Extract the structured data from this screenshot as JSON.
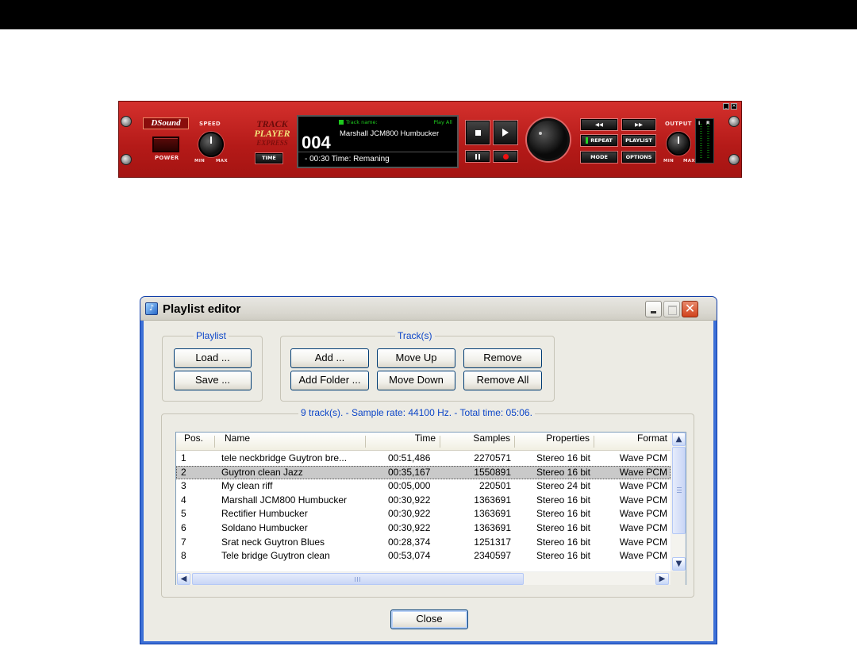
{
  "player": {
    "brand": "DSound",
    "speed_label": "SPEED",
    "power_label": "POWER",
    "min_label": "MIN",
    "max_label": "MAX",
    "logo_line1": "TRACK",
    "logo_line2": "PLAYER",
    "logo_line3": "EXPRESS",
    "time_button": "TIME",
    "display": {
      "track_name_label": "Track name:",
      "mode_label": "Play All",
      "track_number": "004",
      "track_title": "Marshall JCM800 Humbucker",
      "time_text": "- 00:30  Time: Remaning"
    },
    "buttons": {
      "rewind": "◀◀",
      "forward": "▶▶",
      "repeat": "REPEAT",
      "playlist": "PLAYLIST",
      "mode": "MODE",
      "options": "OPTIONS"
    },
    "output_label": "OUTPUT",
    "meter_left": "L",
    "meter_right": "R",
    "accent_color": "#c0201e"
  },
  "dialog": {
    "title": "Playlist editor",
    "playlist_group": "Playlist",
    "load": "Load ...",
    "save": "Save ...",
    "tracks_group": "Track(s)",
    "add": "Add ...",
    "add_folder": "Add Folder ...",
    "move_up": "Move Up",
    "move_down": "Move Down",
    "remove": "Remove",
    "remove_all": "Remove All",
    "summary": "9 track(s). - Sample rate: 44100 Hz. - Total time:   05:06.",
    "close": "Close",
    "columns": {
      "pos": "Pos.",
      "name": "Name",
      "time": "Time",
      "samples": "Samples",
      "properties": "Properties",
      "format": "Format"
    },
    "rows": [
      {
        "pos": "1",
        "name": "tele neckbridge Guytron bre...",
        "time": "00:51,486",
        "samples": "2270571",
        "properties": "Stereo 16 bit",
        "format": "Wave PCM"
      },
      {
        "pos": "2",
        "name": "Guytron clean Jazz",
        "time": "00:35,167",
        "samples": "1550891",
        "properties": "Stereo 16 bit",
        "format": "Wave PCM"
      },
      {
        "pos": "3",
        "name": "My clean riff",
        "time": "00:05,000",
        "samples": "220501",
        "properties": "Stereo 24 bit",
        "format": "Wave PCM"
      },
      {
        "pos": "4",
        "name": "Marshall JCM800 Humbucker",
        "time": "00:30,922",
        "samples": "1363691",
        "properties": "Stereo 16 bit",
        "format": "Wave PCM"
      },
      {
        "pos": "5",
        "name": "Rectifier Humbucker",
        "time": "00:30,922",
        "samples": "1363691",
        "properties": "Stereo 16 bit",
        "format": "Wave PCM"
      },
      {
        "pos": "6",
        "name": "Soldano Humbucker",
        "time": "00:30,922",
        "samples": "1363691",
        "properties": "Stereo 16 bit",
        "format": "Wave PCM"
      },
      {
        "pos": "7",
        "name": "Srat neck Guytron Blues",
        "time": "00:28,374",
        "samples": "1251317",
        "properties": "Stereo 16 bit",
        "format": "Wave PCM"
      },
      {
        "pos": "8",
        "name": "Tele bridge Guytron clean",
        "time": "00:53,074",
        "samples": "2340597",
        "properties": "Stereo 16 bit",
        "format": "Wave PCM"
      }
    ],
    "selected_row": 1,
    "selection_color": "#c9c9c9",
    "group_label_color": "#0d46c8"
  }
}
